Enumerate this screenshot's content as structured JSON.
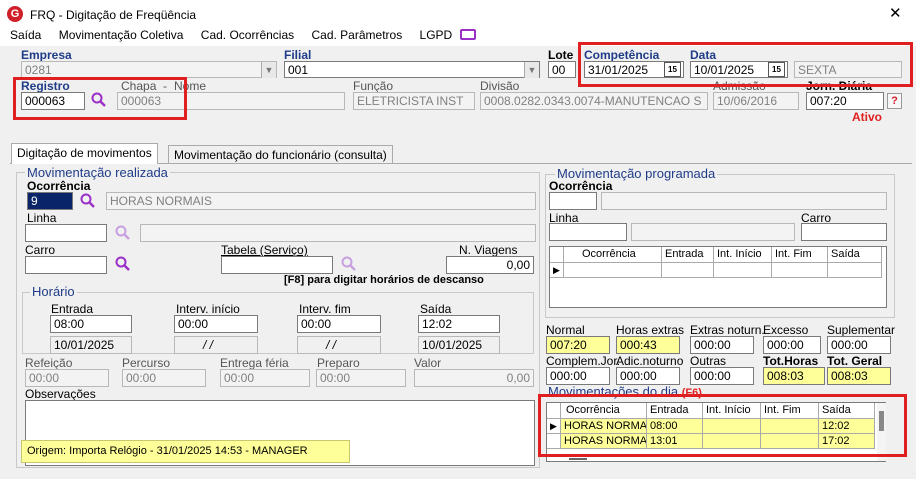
{
  "window": {
    "title": "FRQ - Digitação de Freqüência",
    "close_label": "✕"
  },
  "menu": [
    "Saída",
    "Movimentação Coletiva",
    "Cad. Ocorrências",
    "Cad. Parâmetros",
    "LGPD"
  ],
  "header": {
    "empresa_label": "Empresa",
    "empresa_value": "0281",
    "filial_label": "Filial",
    "filial_value": "001",
    "lote_label": "Lote",
    "lote_value": "00",
    "competencia_label": "Competência",
    "competencia_value": "31/01/2025",
    "data_label": "Data",
    "data_value": "10/01/2025",
    "dia_semana": "SEXTA",
    "cal_icon_text": "15",
    "registro_label": "Registro",
    "registro_value": "000063",
    "chapa_label": "Chapa",
    "nome_label": "Nome",
    "chapa_value": "000063",
    "funcao_label": "Função",
    "funcao_value": "ELETRICISTA INST",
    "divisao_label": "Divisão",
    "divisao_value": "0008.0282.0343.0074-MANUTENCAO S",
    "admissao_label": "Admissão",
    "admissao_value": "10/06/2016",
    "jorn_label": "Jorn. Diária",
    "jorn_value": "007:20",
    "help_label": "?",
    "status": "Ativo"
  },
  "tabs": [
    "Digitação de movimentos",
    "Movimentação do funcionário (consulta)"
  ],
  "realizada": {
    "legend": "Movimentação realizada",
    "ocorrencia_label": "Ocorrência",
    "ocorrencia_code": "9",
    "ocorrencia_desc": "HORAS NORMAIS",
    "linha_label": "Linha",
    "carro_label": "Carro",
    "tabela_label": "Tabela (Serviço)",
    "nviagens_label": "N. Viagens",
    "nviagens_value": "0,00",
    "f8_hint": "[F8] para digitar horários de descanso",
    "horario_legend": "Horário",
    "entrada_label": "Entrada",
    "entrada_value": "08:00",
    "entrada_date": "10/01/2025",
    "interv_inicio_label": "Interv. início",
    "interv_inicio_value": "00:00",
    "interv_inicio_date": "/ /",
    "interv_fim_label": "Interv. fim",
    "interv_fim_value": "00:00",
    "interv_fim_date": "/ /",
    "saida_label": "Saída",
    "saida_value": "12:02",
    "saida_date": "10/01/2025",
    "refeicao_label": "Refeição",
    "refeicao_value": "00:00",
    "percurso_label": "Percurso",
    "percurso_value": "00:00",
    "entrega_label": "Entrega féria",
    "entrega_value": "00:00",
    "preparo_label": "Preparo",
    "preparo_value": "00:00",
    "valor_label": "Valor",
    "valor_value": "0,00",
    "obs_label": "Observações",
    "origem": "Origem: Importa Relógio - 31/01/2025 14:53 - MANAGER"
  },
  "programada": {
    "legend": "Movimentação programada",
    "ocorrencia_label": "Ocorrência",
    "linha_label": "Linha",
    "carro_label": "Carro",
    "columns": [
      "Ocorrência",
      "Entrada",
      "Int. Início",
      "Int. Fim",
      "Saída"
    ]
  },
  "totais": {
    "normal_label": "Normal",
    "normal_value": "007:20",
    "extras_label": "Horas extras",
    "extras_value": "000:43",
    "extras_not_label": "Extras noturn.",
    "extras_not_value": "000:00",
    "excesso_label": "Excesso",
    "excesso_value": "000:00",
    "suplementar_label": "Suplementar",
    "suplementar_value": "000:00",
    "complem_label": "Complem.Jor.",
    "complem_value": "000:00",
    "adic_label": "Adic.noturno",
    "adic_value": "000:00",
    "outras_label": "Outras",
    "outras_value": "000:00",
    "tothoras_label": "Tot.Horas",
    "tothoras_value": "008:03",
    "totgeral_label": "Tot. Geral",
    "totgeral_value": "008:03"
  },
  "dia": {
    "legend": "Movimentações do dia",
    "shortcut": "(F6)",
    "columns": [
      "Ocorrência",
      "Entrada",
      "Int. Início",
      "Int. Fim",
      "Saída"
    ],
    "rows": [
      {
        "ocorrencia": "HORAS NORMAIS",
        "entrada": "08:00",
        "int_inicio": "",
        "int_fim": "",
        "saida": "12:02"
      },
      {
        "ocorrencia": "HORAS NORMAIS",
        "entrada": "13:01",
        "int_inicio": "",
        "int_fim": "",
        "saida": "17:02"
      }
    ]
  },
  "colors": {
    "accent": "#1f3c88",
    "highlight": "#ffff99",
    "annotation": "#e02020",
    "brand": "#d0202a"
  }
}
